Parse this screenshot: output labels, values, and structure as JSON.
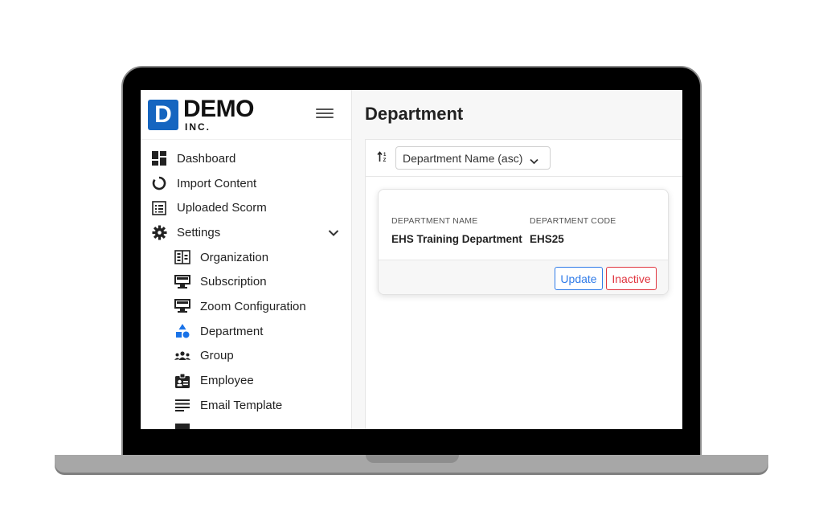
{
  "brand": {
    "mark": "D",
    "name": "DEMO",
    "sub": "INC."
  },
  "sidebar": {
    "items": [
      {
        "label": "Dashboard",
        "icon": "dashboard-icon"
      },
      {
        "label": "Import Content",
        "icon": "import-content-icon"
      },
      {
        "label": "Uploaded Scorm",
        "icon": "uploaded-scorm-icon"
      },
      {
        "label": "Settings",
        "icon": "gear-icon"
      }
    ],
    "settings_items": [
      {
        "label": "Organization",
        "icon": "organization-icon"
      },
      {
        "label": "Subscription",
        "icon": "subscription-icon"
      },
      {
        "label": "Zoom Configuration",
        "icon": "zoom-configuration-icon"
      },
      {
        "label": "Department",
        "icon": "department-icon",
        "active": true
      },
      {
        "label": "Group",
        "icon": "group-icon"
      },
      {
        "label": "Employee",
        "icon": "employee-icon"
      },
      {
        "label": "Email Template",
        "icon": "email-template-icon"
      },
      {
        "label": "",
        "icon": "email-config-icon"
      }
    ]
  },
  "main": {
    "title": "Department",
    "sort": {
      "selected": "Department Name (asc)"
    },
    "card": {
      "name_label": "DEPARTMENT NAME",
      "name_value": "EHS Training Department",
      "code_label": "DEPARTMENT CODE",
      "code_value": "EHS25",
      "update_label": "Update",
      "inactive_label": "Inactive"
    }
  },
  "colors": {
    "accent": "#1565c0",
    "primary": "#2f7be8",
    "danger": "#e0353f",
    "active_icon": "#1a73e8"
  }
}
